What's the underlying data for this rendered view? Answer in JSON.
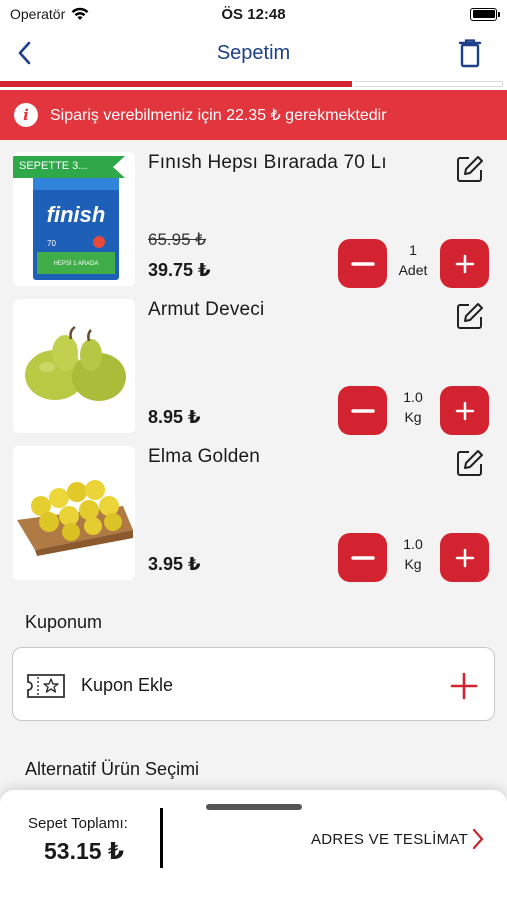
{
  "status": {
    "carrier": "Operatör",
    "time": "ÖS 12:48"
  },
  "nav": {
    "title": "Sepetim"
  },
  "progress": {
    "fraction": 0.7
  },
  "alert": {
    "text": "Sipariş verebilmeniz için 22.35 ₺ gerekmektedir"
  },
  "items": [
    {
      "name": "Fınısh Hepsı Bırarada 70 Lı",
      "badge": "SEPETTE 3...",
      "old_price": "65.95 ₺",
      "price": "39.75 ₺",
      "qty_value": "1",
      "qty_unit": "Adet",
      "image": "finish-detergent-box",
      "brand_text": "finish",
      "box_count": "70",
      "box_caption": "HEPSİ 1 ARADA"
    },
    {
      "name": "Armut Deveci",
      "price": "8.95 ₺",
      "qty_value": "1.0",
      "qty_unit": "Kg",
      "image": "pears"
    },
    {
      "name": "Elma Golden",
      "price": "3.95 ₺",
      "qty_value": "1.0",
      "qty_unit": "Kg",
      "image": "golden-apples-crate"
    }
  ],
  "coupon": {
    "section_title": "Kuponum",
    "add_label": "Kupon Ekle"
  },
  "alternatives": {
    "section_title": "Alternatif Ürün Seçimi"
  },
  "footer": {
    "total_label": "Sepet Toplamı:",
    "total_value": "53.15 ₺",
    "checkout_label": "ADRES VE TESLİMAT"
  },
  "colors": {
    "brand_red": "#d42330",
    "alert_red": "#e3353d",
    "title_blue": "#1e3f8a"
  }
}
